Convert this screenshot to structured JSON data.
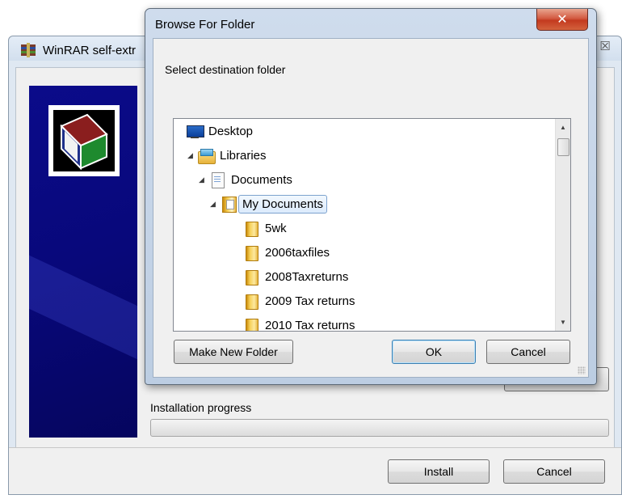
{
  "winrar": {
    "title": "WinRAR self-extr",
    "close_glyph": "☒",
    "progress_label": "Installation progress",
    "progress": 0,
    "install_label": "Install",
    "cancel_label": "Cancel"
  },
  "browse": {
    "title": "Browse For Folder",
    "close_glyph": "✕",
    "prompt": "Select destination folder",
    "tree": [
      {
        "label": "Desktop",
        "icon": "desktop-icon",
        "depth": 0,
        "expander": "",
        "selected": false
      },
      {
        "label": "Libraries",
        "icon": "libraries-icon",
        "depth": 1,
        "expander": "◢",
        "selected": false
      },
      {
        "label": "Documents",
        "icon": "document-icon",
        "depth": 2,
        "expander": "◢",
        "selected": false
      },
      {
        "label": "My Documents",
        "icon": "my-documents-icon",
        "depth": 3,
        "expander": "◢",
        "selected": true
      },
      {
        "label": "5wk",
        "icon": "folder-icon",
        "depth": 4,
        "expander": "",
        "selected": false
      },
      {
        "label": "2006taxfiles",
        "icon": "folder-icon",
        "depth": 4,
        "expander": "",
        "selected": false
      },
      {
        "label": "2008Taxreturns",
        "icon": "folder-icon",
        "depth": 4,
        "expander": "",
        "selected": false
      },
      {
        "label": "2009 Tax returns",
        "icon": "folder-icon",
        "depth": 4,
        "expander": "",
        "selected": false
      },
      {
        "label": "2010 Tax returns",
        "icon": "folder-icon",
        "depth": 4,
        "expander": "",
        "selected": false
      }
    ],
    "scroll_up_glyph": "▲",
    "scroll_down_glyph": "▼",
    "make_new_folder_label": "Make New Folder",
    "ok_label": "OK",
    "cancel_label": "Cancel"
  }
}
